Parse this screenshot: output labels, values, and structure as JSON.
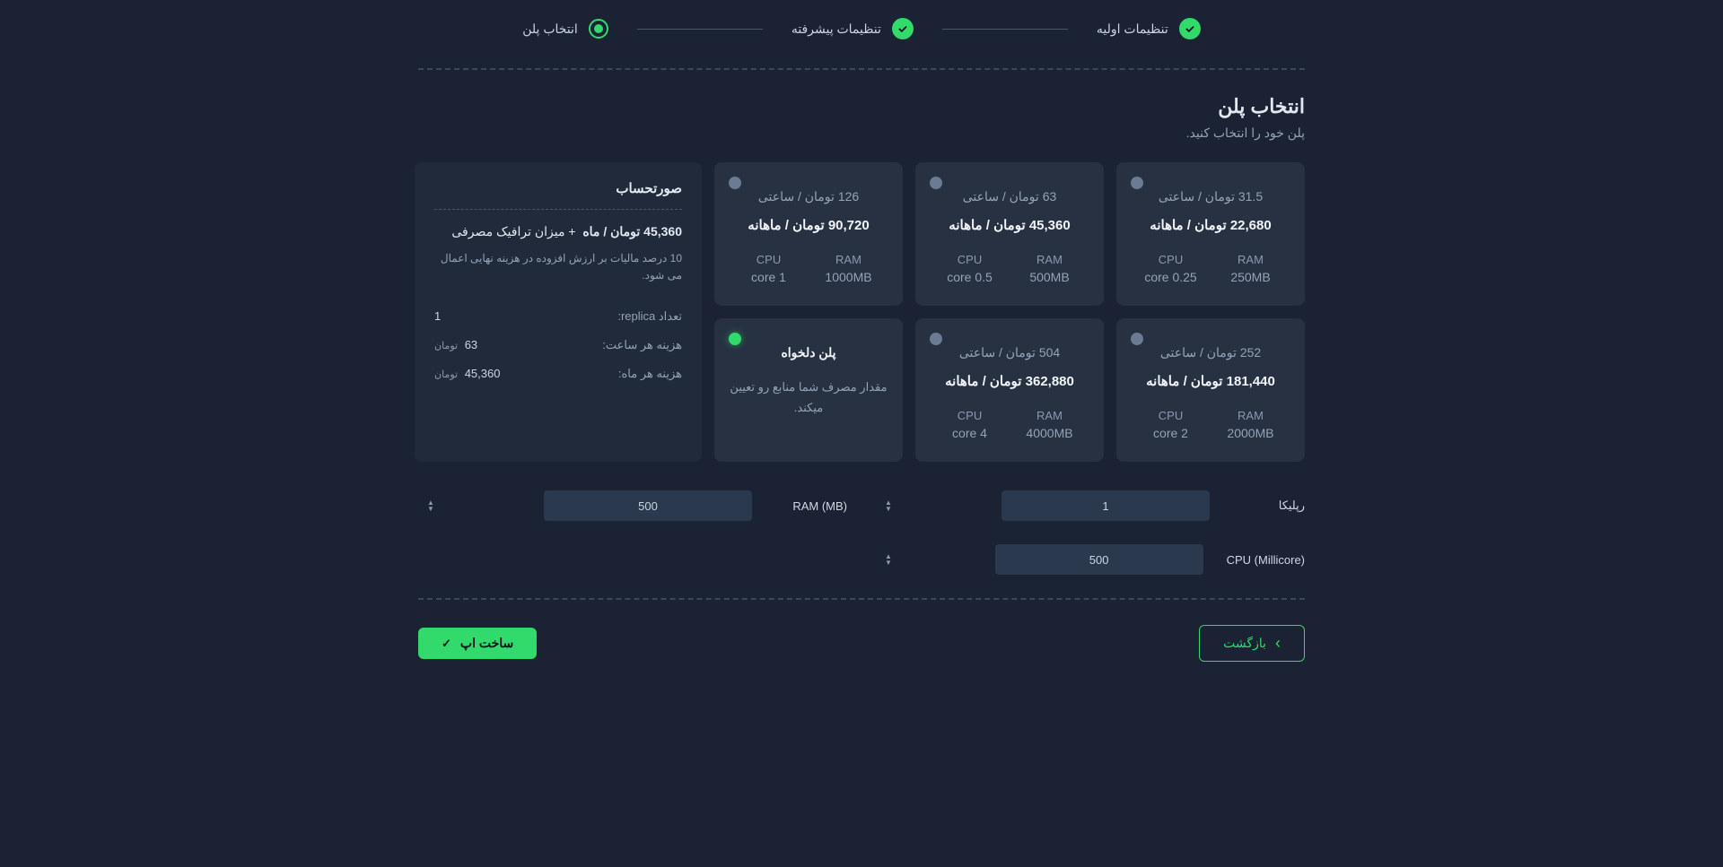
{
  "stepper": {
    "step1": "تنظیمات اولیه",
    "step2": "تنظیمات پیشرفته",
    "step3": "انتخاب پلن"
  },
  "heading": "انتخاب پلن",
  "subheading": "پلن خود را انتخاب کنید.",
  "plans": [
    {
      "hourly": "31.5 تومان / ساعتی",
      "monthly": "22,680 تومان / ماهانه",
      "ram_label": "RAM",
      "ram": "250MB",
      "cpu_label": "CPU",
      "cpu": "0.25 core"
    },
    {
      "hourly": "63 تومان / ساعتی",
      "monthly": "45,360 تومان / ماهانه",
      "ram_label": "RAM",
      "ram": "500MB",
      "cpu_label": "CPU",
      "cpu": "0.5 core"
    },
    {
      "hourly": "126 تومان / ساعتی",
      "monthly": "90,720 تومان / ماهانه",
      "ram_label": "RAM",
      "ram": "1000MB",
      "cpu_label": "CPU",
      "cpu": "1 core"
    },
    {
      "hourly": "252 تومان / ساعتی",
      "monthly": "181,440 تومان / ماهانه",
      "ram_label": "RAM",
      "ram": "2000MB",
      "cpu_label": "CPU",
      "cpu": "2 core"
    },
    {
      "hourly": "504 تومان / ساعتی",
      "monthly": "362,880 تومان / ماهانه",
      "ram_label": "RAM",
      "ram": "4000MB",
      "cpu_label": "CPU",
      "cpu": "4 core"
    }
  ],
  "custom_plan": {
    "title": "پلن دلخواه",
    "desc": "مقدار مصرف شما منابع رو تعیین میکند."
  },
  "billing": {
    "title": "صورتحساب",
    "total_value": "45,360 تومان / ماه",
    "total_suffix": "+ میزان ترافیک مصرفی",
    "tax_note": "10 درصد مالیات بر ارزش افزوده در هزینه نهایی اعمال می شود.",
    "replica_label": "تعداد replica:",
    "replica_value": "1",
    "hourly_label": "هزینه هر ساعت:",
    "hourly_value": "63",
    "hourly_unit": "تومان",
    "monthly_label": "هزینه هر ماه:",
    "monthly_value": "45,360",
    "monthly_unit": "تومان"
  },
  "form": {
    "replica_label": "رپلیکا",
    "replica_value": "1",
    "ram_label": "RAM (MB)",
    "ram_value": "500",
    "cpu_label": "CPU (Millicore)",
    "cpu_value": "500"
  },
  "buttons": {
    "back": "بازگشت",
    "create": "ساخت اپ"
  }
}
